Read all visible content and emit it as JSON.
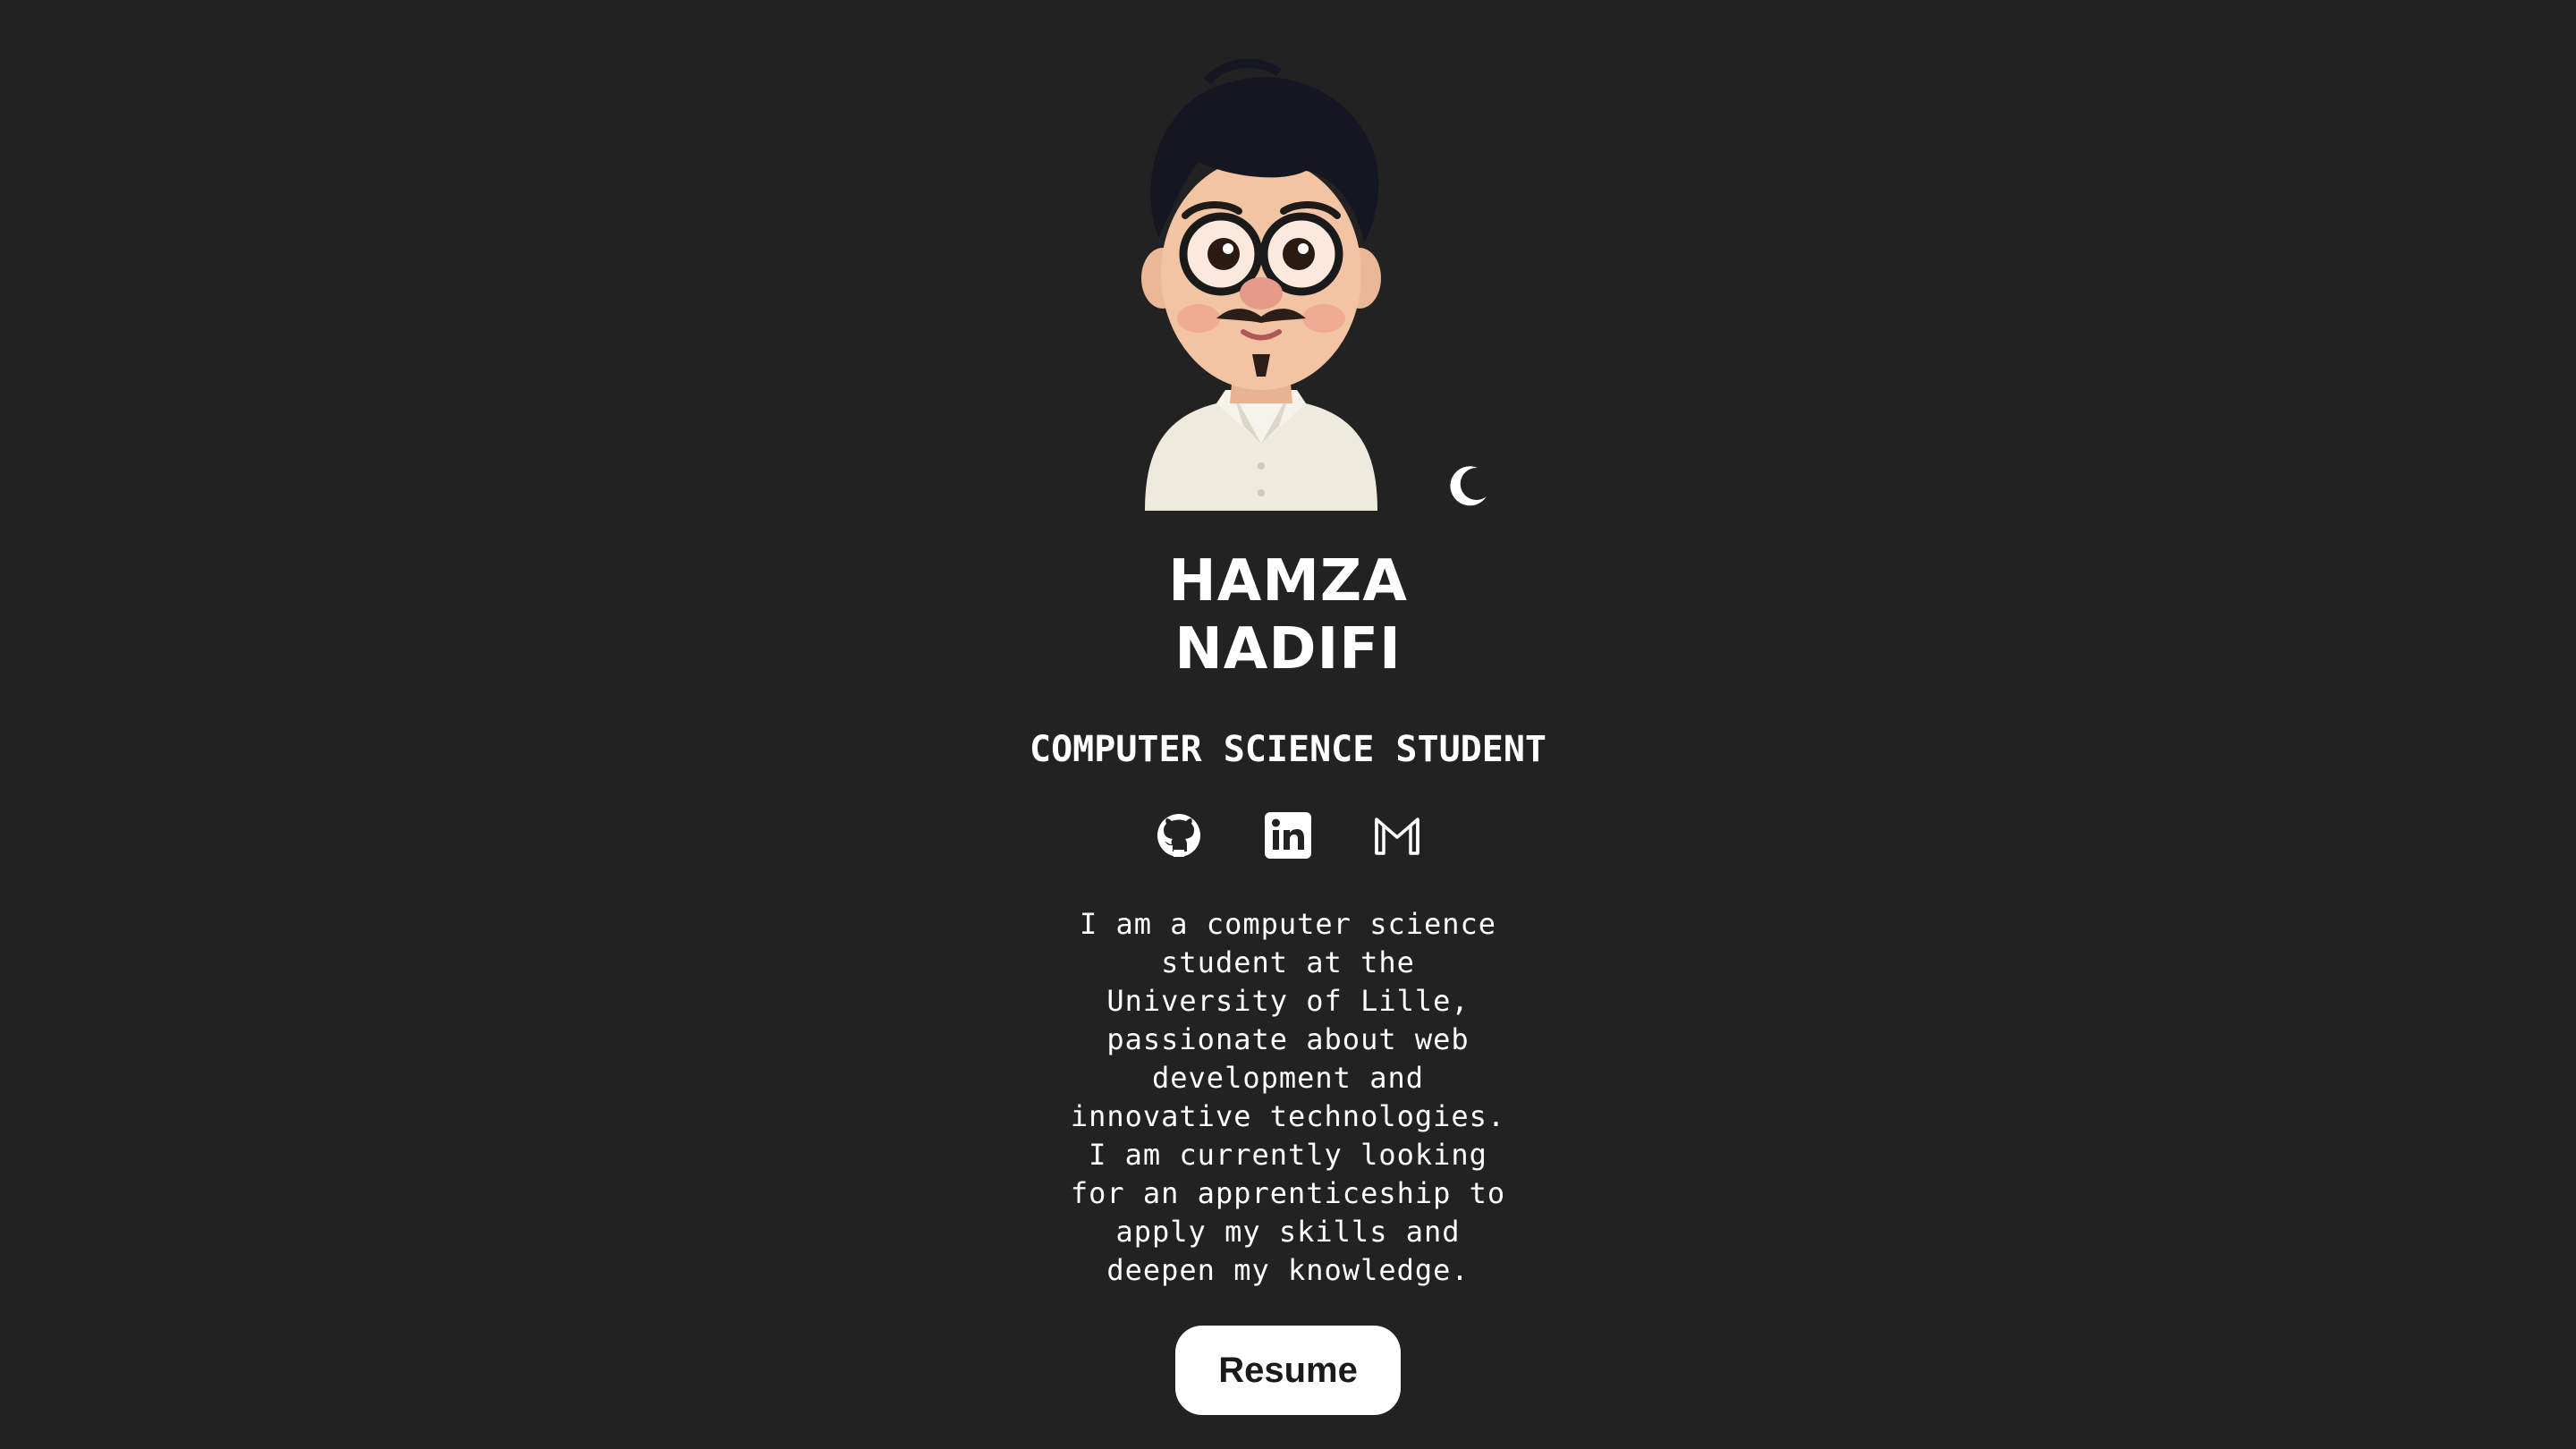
{
  "profile": {
    "first_name": "HAMZA",
    "last_name": "NADIFI",
    "role": "COMPUTER SCIENCE STUDENT",
    "bio": "I am a computer science\nstudent at the\nUniversity of Lille,\npassionate about web\ndevelopment and\ninnovative technologies.\nI am currently looking\nfor an apprenticeship to\napply my skills and\ndeepen my knowledge."
  },
  "avatar": {
    "icon": "cartoon-avatar"
  },
  "theme_toggle": {
    "icon": "moon-icon"
  },
  "socials": [
    {
      "icon": "github-icon"
    },
    {
      "icon": "linkedin-icon"
    },
    {
      "icon": "gmail-icon"
    }
  ],
  "actions": {
    "resume_label": "Resume"
  },
  "colors": {
    "background": "#222222",
    "text": "#ffffff",
    "button_bg": "#ffffff",
    "button_text": "#1a1a1a"
  }
}
